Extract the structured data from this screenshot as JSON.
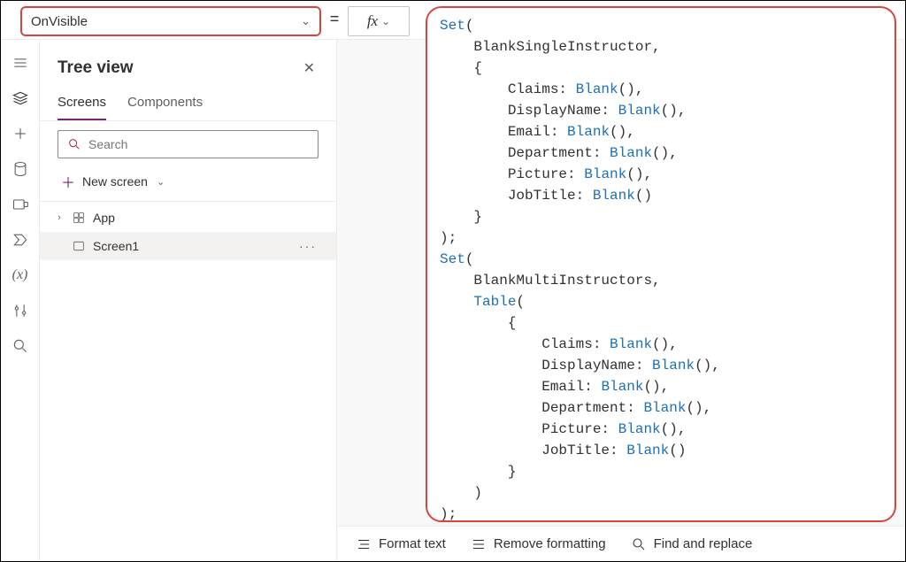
{
  "propertySelector": {
    "value": "OnVisible"
  },
  "equals": "=",
  "fxLabel": "fx",
  "treeView": {
    "title": "Tree view",
    "tabs": {
      "screens": "Screens",
      "components": "Components"
    },
    "searchPlaceholder": "Search",
    "newScreen": "New screen",
    "items": {
      "app": "App",
      "screen1": "Screen1"
    }
  },
  "variableIcon": "(x)",
  "formula": {
    "tokens": [
      {
        "t": "fn",
        "v": "Set"
      },
      {
        "t": "txt",
        "v": "("
      },
      {
        "t": "nl"
      },
      {
        "t": "sp",
        "n": 4
      },
      {
        "t": "txt",
        "v": "BlankSingleInstructor,"
      },
      {
        "t": "nl"
      },
      {
        "t": "sp",
        "n": 4
      },
      {
        "t": "txt",
        "v": "{"
      },
      {
        "t": "nl"
      },
      {
        "t": "sp",
        "n": 8
      },
      {
        "t": "txt",
        "v": "Claims: "
      },
      {
        "t": "fn",
        "v": "Blank"
      },
      {
        "t": "txt",
        "v": "(),"
      },
      {
        "t": "nl"
      },
      {
        "t": "sp",
        "n": 8
      },
      {
        "t": "txt",
        "v": "DisplayName: "
      },
      {
        "t": "fn",
        "v": "Blank"
      },
      {
        "t": "txt",
        "v": "(),"
      },
      {
        "t": "nl"
      },
      {
        "t": "sp",
        "n": 8
      },
      {
        "t": "txt",
        "v": "Email: "
      },
      {
        "t": "fn",
        "v": "Blank"
      },
      {
        "t": "txt",
        "v": "(),"
      },
      {
        "t": "nl"
      },
      {
        "t": "sp",
        "n": 8
      },
      {
        "t": "txt",
        "v": "Department: "
      },
      {
        "t": "fn",
        "v": "Blank"
      },
      {
        "t": "txt",
        "v": "(),"
      },
      {
        "t": "nl"
      },
      {
        "t": "sp",
        "n": 8
      },
      {
        "t": "txt",
        "v": "Picture: "
      },
      {
        "t": "fn",
        "v": "Blank"
      },
      {
        "t": "txt",
        "v": "(),"
      },
      {
        "t": "nl"
      },
      {
        "t": "sp",
        "n": 8
      },
      {
        "t": "txt",
        "v": "JobTitle: "
      },
      {
        "t": "fn",
        "v": "Blank"
      },
      {
        "t": "txt",
        "v": "()"
      },
      {
        "t": "nl"
      },
      {
        "t": "sp",
        "n": 4
      },
      {
        "t": "txt",
        "v": "}"
      },
      {
        "t": "nl"
      },
      {
        "t": "txt",
        "v": ");"
      },
      {
        "t": "nl"
      },
      {
        "t": "fn",
        "v": "Set"
      },
      {
        "t": "txt",
        "v": "("
      },
      {
        "t": "nl"
      },
      {
        "t": "sp",
        "n": 4
      },
      {
        "t": "txt",
        "v": "BlankMultiInstructors,"
      },
      {
        "t": "nl"
      },
      {
        "t": "sp",
        "n": 4
      },
      {
        "t": "fn",
        "v": "Table"
      },
      {
        "t": "txt",
        "v": "("
      },
      {
        "t": "nl"
      },
      {
        "t": "sp",
        "n": 8
      },
      {
        "t": "txt",
        "v": "{"
      },
      {
        "t": "nl"
      },
      {
        "t": "sp",
        "n": 12
      },
      {
        "t": "txt",
        "v": "Claims: "
      },
      {
        "t": "fn",
        "v": "Blank"
      },
      {
        "t": "txt",
        "v": "(),"
      },
      {
        "t": "nl"
      },
      {
        "t": "sp",
        "n": 12
      },
      {
        "t": "txt",
        "v": "DisplayName: "
      },
      {
        "t": "fn",
        "v": "Blank"
      },
      {
        "t": "txt",
        "v": "(),"
      },
      {
        "t": "nl"
      },
      {
        "t": "sp",
        "n": 12
      },
      {
        "t": "txt",
        "v": "Email: "
      },
      {
        "t": "fn",
        "v": "Blank"
      },
      {
        "t": "txt",
        "v": "(),"
      },
      {
        "t": "nl"
      },
      {
        "t": "sp",
        "n": 12
      },
      {
        "t": "txt",
        "v": "Department: "
      },
      {
        "t": "fn",
        "v": "Blank"
      },
      {
        "t": "txt",
        "v": "(),"
      },
      {
        "t": "nl"
      },
      {
        "t": "sp",
        "n": 12
      },
      {
        "t": "txt",
        "v": "Picture: "
      },
      {
        "t": "fn",
        "v": "Blank"
      },
      {
        "t": "txt",
        "v": "(),"
      },
      {
        "t": "nl"
      },
      {
        "t": "sp",
        "n": 12
      },
      {
        "t": "txt",
        "v": "JobTitle: "
      },
      {
        "t": "fn",
        "v": "Blank"
      },
      {
        "t": "txt",
        "v": "()"
      },
      {
        "t": "nl"
      },
      {
        "t": "sp",
        "n": 8
      },
      {
        "t": "txt",
        "v": "}"
      },
      {
        "t": "nl"
      },
      {
        "t": "sp",
        "n": 4
      },
      {
        "t": "txt",
        "v": ")"
      },
      {
        "t": "nl"
      },
      {
        "t": "txt",
        "v": ");"
      }
    ]
  },
  "bottomBar": {
    "format": "Format text",
    "remove": "Remove formatting",
    "find": "Find and replace"
  }
}
